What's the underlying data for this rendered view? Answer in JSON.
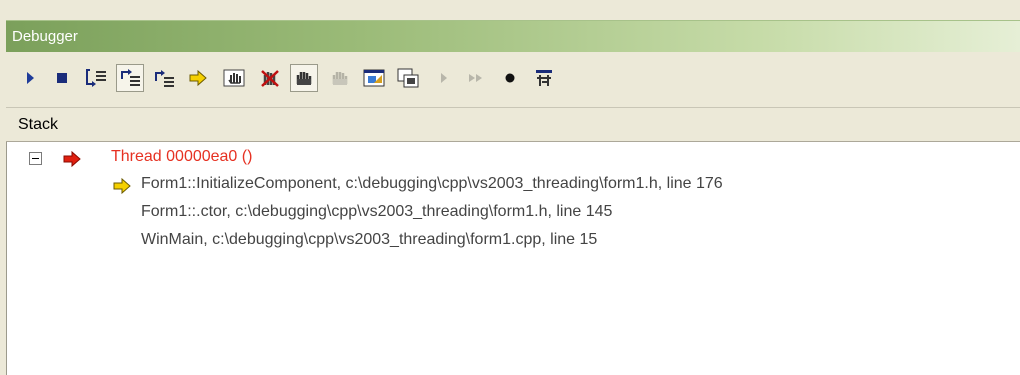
{
  "window": {
    "title": "Debugger"
  },
  "toolbar": {
    "buttons": [
      {
        "name": "run-icon"
      },
      {
        "name": "stop-icon"
      },
      {
        "name": "step-into-icon"
      },
      {
        "name": "step-over-icon"
      },
      {
        "name": "step-out-icon"
      },
      {
        "name": "show-next-statement-icon"
      },
      {
        "name": "hand-pointer-icon"
      },
      {
        "name": "hand-cancel-icon"
      },
      {
        "name": "hand-grab-icon"
      },
      {
        "name": "hand-disabled-icon"
      },
      {
        "name": "window-image-icon"
      },
      {
        "name": "window-stack-icon"
      },
      {
        "name": "play-disabled-icon"
      },
      {
        "name": "fast-forward-disabled-icon"
      },
      {
        "name": "breakpoint-icon"
      },
      {
        "name": "filter-icon"
      }
    ]
  },
  "stack": {
    "header": "Stack",
    "thread": {
      "label": "Thread 00000ea0 ()"
    },
    "frames": [
      {
        "text": "Form1::InitializeComponent, c:\\debugging\\cpp\\vs2003_threading\\form1.h, line 176",
        "current": true
      },
      {
        "text": "Form1::.ctor, c:\\debugging\\cpp\\vs2003_threading\\form1.h, line 145",
        "current": false
      },
      {
        "text": "WinMain, c:\\debugging\\cpp\\vs2003_threading\\form1.cpp, line 15",
        "current": false
      }
    ]
  },
  "colors": {
    "title_bar": "#9bbb78",
    "thread_text": "#e63122",
    "current_arrow": "#f5d000",
    "thread_arrow": "#e02010"
  }
}
